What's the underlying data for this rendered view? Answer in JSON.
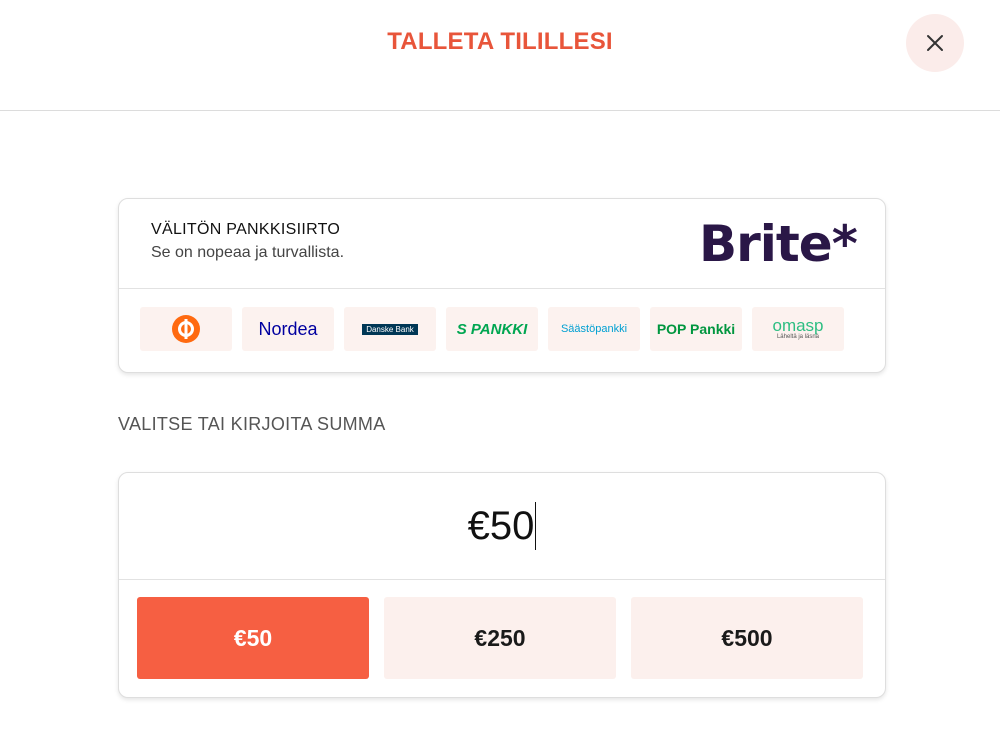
{
  "header": {
    "title": "TALLETA TILILLESI",
    "close_icon": "close-icon"
  },
  "payment_method": {
    "title": "VÄLITÖN PANKKISIIRTO",
    "subtitle": "Se on nopeaa ja turvallista.",
    "provider_logo": "Brite*",
    "banks": [
      {
        "id": "op",
        "label": "",
        "color": "#ff6a10"
      },
      {
        "id": "nordea",
        "label": "Nordea",
        "color": "#0000a0"
      },
      {
        "id": "danske",
        "label": "Danske Bank",
        "color": "#003755"
      },
      {
        "id": "s-pankki",
        "label": "S PANKKI",
        "color": "#00a651"
      },
      {
        "id": "saastopankki",
        "label": "Säästöpankki",
        "color": "#00a0d2"
      },
      {
        "id": "pop",
        "label": "POP Pankki",
        "color": "#00963f"
      },
      {
        "id": "omasp",
        "label": "omasp",
        "sublabel": "Läheltä ja läsnä",
        "color": "#2dbe82"
      }
    ]
  },
  "amount": {
    "section_label": "VALITSE TAI KIRJOITA SUMMA",
    "value": "€50",
    "presets": [
      "€50",
      "€250",
      "€500"
    ],
    "selected_index": 0
  },
  "colors": {
    "accent": "#f65f42",
    "title": "#e8553a",
    "tile_bg": "#fcf0ed",
    "brite": "#2a1747"
  }
}
